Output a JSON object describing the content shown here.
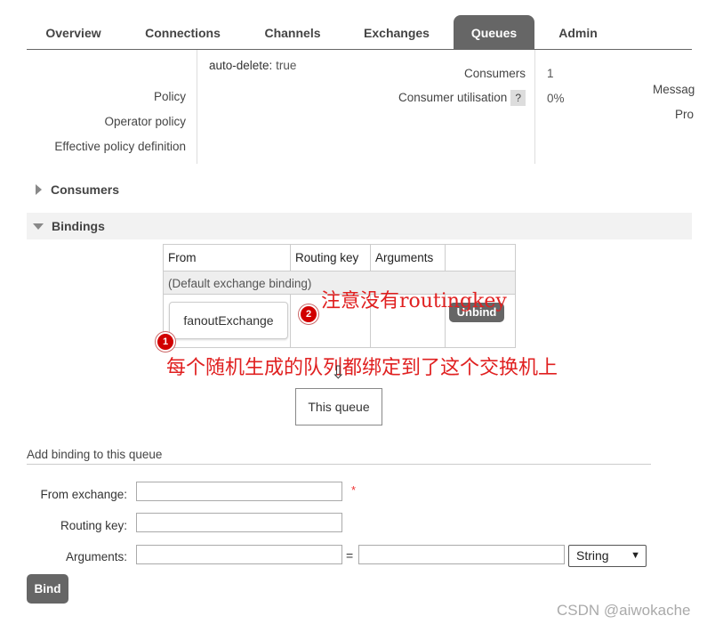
{
  "tabs": [
    "Overview",
    "Connections",
    "Channels",
    "Exchanges",
    "Queues",
    "Admin"
  ],
  "details": {
    "auto_delete_key": "auto-delete:",
    "auto_delete_value": "true",
    "policy_label": "Policy",
    "operator_policy_label": "Operator policy",
    "effective_policy_label": "Effective policy definition",
    "consumers_label": "Consumers",
    "consumers_value": "1",
    "consumer_util_label": "Consumer utilisation",
    "consumer_util_help": "?",
    "consumer_util_value": "0%",
    "messages_label": "Messag",
    "process_label": "Pro"
  },
  "sections": {
    "consumers": "Consumers",
    "bindings": "Bindings"
  },
  "bindings_table": {
    "headers": [
      "From",
      "Routing key",
      "Arguments"
    ],
    "default_row": "(Default exchange binding)",
    "row_from": "fanoutExchange",
    "unbind_label": "Unbind"
  },
  "annotations": {
    "badge1": "1",
    "badge2": "2",
    "note_routingkey": "注意没有routingkey",
    "note_queue": "每个随机生成的队列都绑定到了这个交换机上"
  },
  "arrow": "⇩",
  "this_queue": "This queue",
  "add_binding": {
    "title": "Add binding to this queue",
    "from_exchange_label": "From exchange:",
    "required_mark": "*",
    "routing_key_label": "Routing key:",
    "arguments_label": "Arguments:",
    "equals": "=",
    "type_selected": "String",
    "bind_label": "Bind"
  },
  "watermark": "CSDN @aiwokache"
}
